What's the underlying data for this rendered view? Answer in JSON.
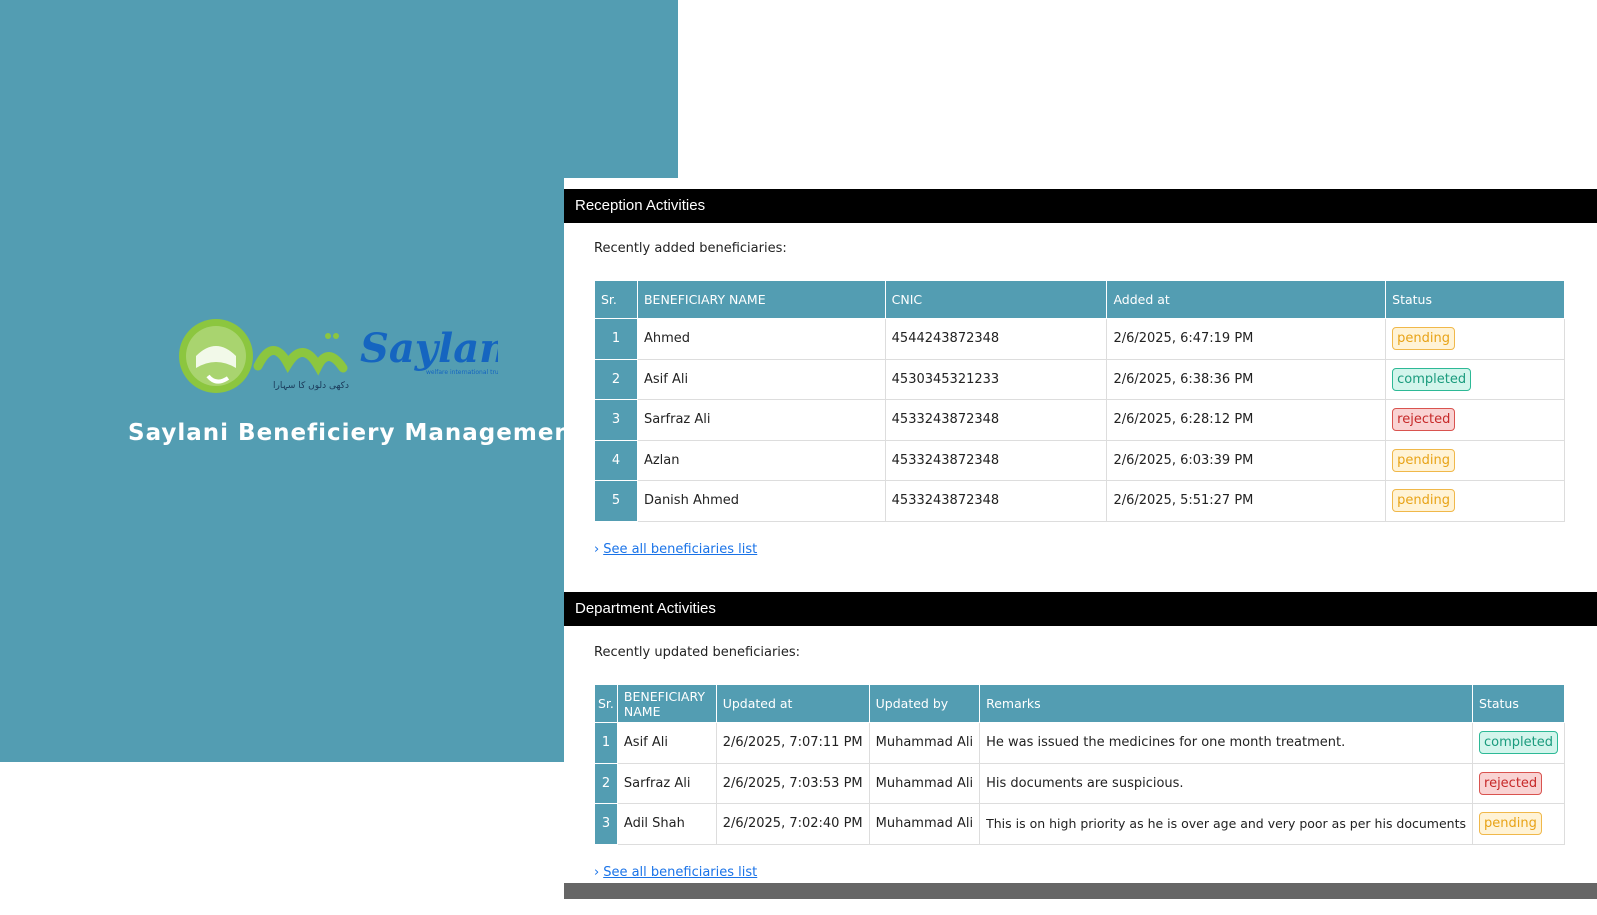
{
  "brand": {
    "logo_latin": "Saylani",
    "logo_urdu": "سیلانی",
    "logo_tagline": "welfare international trust",
    "logo_urdu_tagline": "دکھی دلوں کا سہارا",
    "title": "Saylani Beneficiery Management"
  },
  "colors": {
    "brand_teal": "#539db2",
    "header_black": "#000000",
    "pending": "#e8a317",
    "completed": "#1a9b7d",
    "rejected": "#c62828",
    "link": "#1a73e8"
  },
  "reception": {
    "heading": "Reception Activities",
    "subtitle": "Recently added beneficiaries:",
    "columns": [
      "Sr.",
      "BENEFICIARY NAME",
      "CNIC",
      "Added at",
      "Status"
    ],
    "rows": [
      {
        "sr": "1",
        "name": "Ahmed",
        "cnic": "4544243872348",
        "added_at": "2/6/2025, 6:47:19 PM",
        "status": "pending"
      },
      {
        "sr": "2",
        "name": "Asif Ali",
        "cnic": "4530345321233",
        "added_at": "2/6/2025, 6:38:36 PM",
        "status": "completed"
      },
      {
        "sr": "3",
        "name": "Sarfraz Ali",
        "cnic": "4533243872348",
        "added_at": "2/6/2025, 6:28:12 PM",
        "status": "rejected"
      },
      {
        "sr": "4",
        "name": "Azlan",
        "cnic": "4533243872348",
        "added_at": "2/6/2025, 6:03:39 PM",
        "status": "pending"
      },
      {
        "sr": "5",
        "name": "Danish Ahmed",
        "cnic": "4533243872348",
        "added_at": "2/6/2025, 5:51:27 PM",
        "status": "pending"
      }
    ],
    "see_all_arrow": "›",
    "see_all_label": "See all beneficiaries list"
  },
  "department": {
    "heading": "Department Activities",
    "subtitle": "Recently updated beneficiaries:",
    "columns": [
      "Sr.",
      "BENEFICIARY NAME",
      "Updated at",
      "Updated by",
      "Remarks",
      "Status"
    ],
    "rows": [
      {
        "sr": "1",
        "name": "Asif Ali",
        "updated_at": "2/6/2025, 7:07:11 PM",
        "updated_by": "Muhammad Ali",
        "remarks": "He was issued the medicines for one month treatment.",
        "status": "completed"
      },
      {
        "sr": "2",
        "name": "Sarfraz Ali",
        "updated_at": "2/6/2025, 7:03:53 PM",
        "updated_by": "Muhammad Ali",
        "remarks": "His documents are suspicious.",
        "status": "rejected"
      },
      {
        "sr": "3",
        "name": "Adil Shah",
        "updated_at": "2/6/2025, 7:02:40 PM",
        "updated_by": "Muhammad Ali",
        "remarks": "This is on high priority as he is over age and very poor as per his documents",
        "status": "pending"
      }
    ],
    "see_all_arrow": "›",
    "see_all_label": "See all beneficiaries list"
  }
}
